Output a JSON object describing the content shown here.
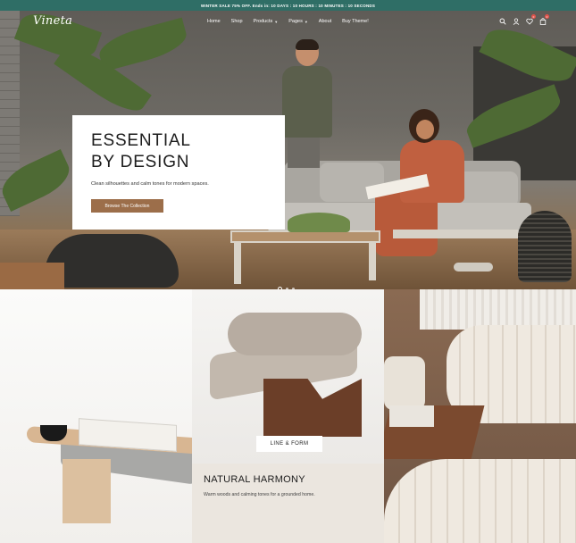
{
  "announcement": "WINTER SALE 75% OFF. Ends in: 10 DAYS : 10 HOURS : 10 MINUTES : 10 SECONDS",
  "header": {
    "logo": "Vineta",
    "nav": [
      {
        "label": "Home",
        "has_caret": false
      },
      {
        "label": "Shop",
        "has_caret": false
      },
      {
        "label": "Products",
        "has_caret": true
      },
      {
        "label": "Pages",
        "has_caret": true
      },
      {
        "label": "About",
        "has_caret": false
      },
      {
        "label": "Buy Theme!",
        "has_caret": false
      }
    ],
    "icons": [
      "search-icon",
      "user-icon",
      "heart-icon",
      "cart-icon"
    ],
    "wishlist_count": "0",
    "cart_count": "0"
  },
  "hero": {
    "title_line1": "ESSENTIAL",
    "title_line2": "BY DESIGN",
    "subtitle": "Clean silhouettes and calm tones for modern spaces.",
    "button": "Browse The Collection",
    "slide_count": 3,
    "active_slide": 1
  },
  "tiles": {
    "middle_label": "LINE & FORM",
    "middle_title": "NATURAL HARMONY",
    "middle_subtitle": "Warm woods and calming tones for a grounded home."
  },
  "colors": {
    "announcement_bg": "#2f6e66",
    "button_bg": "#9c6e4a",
    "badge": "#e2534b"
  }
}
